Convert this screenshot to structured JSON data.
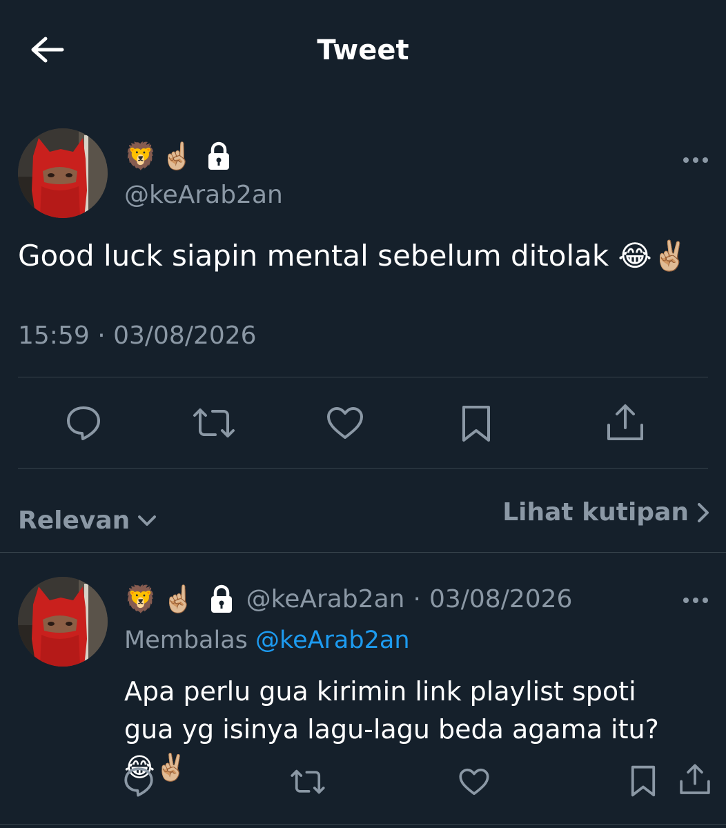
{
  "header": {
    "title": "Tweet"
  },
  "tweet": {
    "name_emojis": [
      "🦁",
      "☝🏼"
    ],
    "handle": "@keArab2an",
    "text": "Good luck siapin mental sebelum ditolak 😂✌🏼",
    "timestamp": "15:59 · 03/08/2026"
  },
  "sort": {
    "label": "Relevan"
  },
  "quotes": {
    "label": "Lihat kutipan"
  },
  "reply": {
    "name_emojis": [
      "🦁",
      "☝🏼"
    ],
    "handle": "@keArab2an",
    "separator": "·",
    "date": "03/08/2026",
    "replying_label": "Membalas",
    "replying_to": "@keArab2an",
    "text": "Apa perlu gua kirimin link playlist spoti gua yg isinya lagu-lagu beda agama itu? 😂✌🏼"
  },
  "colors": {
    "background": "#15202b",
    "text_primary": "#ffffff",
    "text_secondary": "#8b98a5",
    "accent": "#1d9bf0",
    "divider": "#38444d"
  },
  "icons": {
    "back": "arrow-left-icon",
    "lock": "lock-icon",
    "more": "more-horizontal-icon",
    "reply": "comment-icon",
    "retweet": "retweet-icon",
    "like": "heart-icon",
    "bookmark": "bookmark-icon",
    "share": "share-icon",
    "dropdown": "chevron-down-icon",
    "link": "chevron-right-icon"
  }
}
